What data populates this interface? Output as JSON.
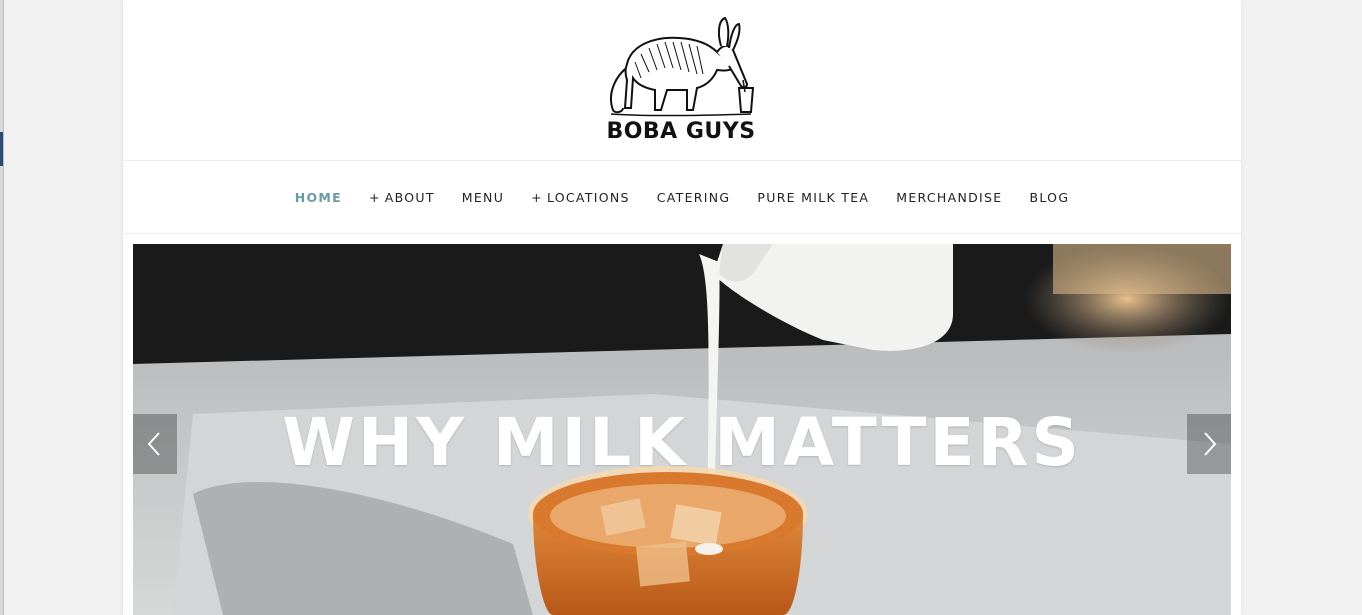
{
  "brand": {
    "name": "BOBA GUYS"
  },
  "nav": {
    "items": [
      {
        "label": "HOME",
        "prefix": ""
      },
      {
        "label": "ABOUT",
        "prefix": "+"
      },
      {
        "label": "MENU",
        "prefix": ""
      },
      {
        "label": "LOCATIONS",
        "prefix": "+"
      },
      {
        "label": "CATERING",
        "prefix": ""
      },
      {
        "label": "PURE MILK TEA",
        "prefix": ""
      },
      {
        "label": "MERCHANDISE",
        "prefix": ""
      },
      {
        "label": "BLOG",
        "prefix": ""
      }
    ],
    "active": "HOME"
  },
  "hero": {
    "title": "WHY MILK MATTERS",
    "prev_icon": "chevron-left-icon",
    "next_icon": "chevron-right-icon"
  },
  "colors": {
    "nav_active": "#6a9aa8",
    "nav_text": "#222222",
    "page_bg": "#ffffff",
    "outer_bg": "#f1f1f1"
  }
}
